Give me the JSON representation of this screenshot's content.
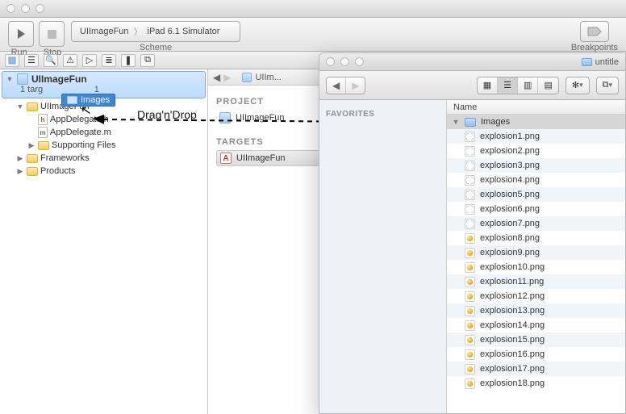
{
  "toolbar": {
    "run_label": "Run",
    "stop_label": "Stop",
    "scheme_label": "Scheme",
    "scheme_target": "UIImageFun",
    "scheme_dest": "iPad 6.1 Simulator",
    "breakpoints_label": "Breakpoints"
  },
  "navigator": {
    "project_name": "UIImageFun",
    "project_sub_prefix": "1 targ",
    "project_sub_suffix": "1",
    "items": [
      {
        "label": "UIImageFun",
        "type": "folder-yel",
        "indent": 1,
        "open": true
      },
      {
        "label": "AppDelegate.h",
        "type": "h",
        "indent": 2
      },
      {
        "label": "AppDelegate.m",
        "type": "m",
        "indent": 2
      },
      {
        "label": "Supporting Files",
        "type": "folder-yel",
        "indent": 2,
        "closed": true
      },
      {
        "label": "Frameworks",
        "type": "folder-yel",
        "indent": 1,
        "closed": true
      },
      {
        "label": "Products",
        "type": "folder-yel",
        "indent": 1,
        "closed": true
      }
    ]
  },
  "drag_chip": {
    "label": "Images"
  },
  "annotation": {
    "label": "Drag'n'Drop"
  },
  "jumpbar": {
    "item": "UIIm..."
  },
  "project_pane": {
    "section_project": "PROJECT",
    "project_item": "UIImageFun",
    "section_targets": "TARGETS",
    "target_item": "UIImageFun"
  },
  "finder": {
    "title": "untitle",
    "sidebar_header": "FAVORITES",
    "column_name": "Name",
    "folder_row": "Images",
    "files": [
      {
        "name": "explosion1.png",
        "empty": true
      },
      {
        "name": "explosion2.png",
        "empty": true
      },
      {
        "name": "explosion3.png",
        "empty": true
      },
      {
        "name": "explosion4.png",
        "empty": true
      },
      {
        "name": "explosion5.png",
        "empty": true
      },
      {
        "name": "explosion6.png",
        "empty": true
      },
      {
        "name": "explosion7.png",
        "empty": true
      },
      {
        "name": "explosion8.png",
        "empty": false
      },
      {
        "name": "explosion9.png",
        "empty": false
      },
      {
        "name": "explosion10.png",
        "empty": false
      },
      {
        "name": "explosion11.png",
        "empty": false
      },
      {
        "name": "explosion12.png",
        "empty": false
      },
      {
        "name": "explosion13.png",
        "empty": false
      },
      {
        "name": "explosion14.png",
        "empty": false
      },
      {
        "name": "explosion15.png",
        "empty": false
      },
      {
        "name": "explosion16.png",
        "empty": false
      },
      {
        "name": "explosion17.png",
        "empty": false
      },
      {
        "name": "explosion18.png",
        "empty": false
      }
    ]
  }
}
